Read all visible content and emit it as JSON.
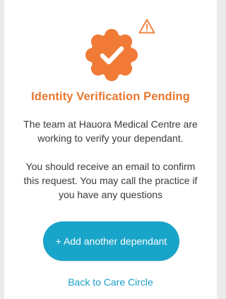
{
  "status": {
    "title": "Identity Verification Pending",
    "message_lines": [
      "The team at Hauora Medical Centre are",
      "working to verify your dependant."
    ],
    "info_lines": [
      "You should receive an email to confirm",
      "this request. You may call the practice if",
      "you have any questions"
    ],
    "badge_icon": "check-badge-icon",
    "warning_icon": "warning-triangle-icon"
  },
  "actions": {
    "add_label": "+ Add another dependant",
    "back_label": "Back to Care Circle"
  },
  "colors": {
    "accent_orange": "#f07a36",
    "title_orange": "#e87830",
    "button_blue": "#19a4c9",
    "link_blue": "#1a9ec7"
  }
}
